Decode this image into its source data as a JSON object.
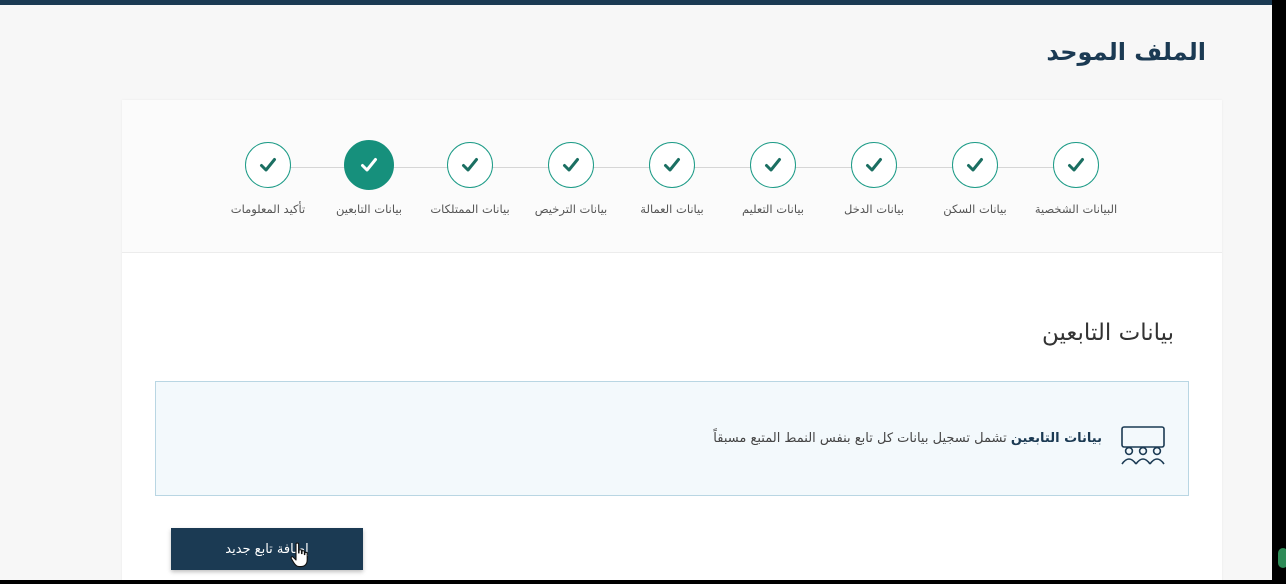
{
  "page": {
    "title": "الملف الموحد"
  },
  "stepper": {
    "steps": [
      {
        "label": "البيانات الشخصية",
        "state": "done"
      },
      {
        "label": "بيانات السكن",
        "state": "done"
      },
      {
        "label": "بيانات الدخل",
        "state": "done"
      },
      {
        "label": "بيانات التعليم",
        "state": "done"
      },
      {
        "label": "بيانات العمالة",
        "state": "done"
      },
      {
        "label": "بيانات الترخيص",
        "state": "done"
      },
      {
        "label": "بيانات الممتلكات",
        "state": "done"
      },
      {
        "label": "بيانات التابعين",
        "state": "active"
      },
      {
        "label": "تأكيد المعلومات",
        "state": "done"
      }
    ]
  },
  "section": {
    "title": "بيانات التابعين",
    "info_bold": "بيانات التابعين",
    "info_text": " تشمل تسجيل بيانات كل تابع بنفس النمط المتبع مسبقاً"
  },
  "actions": {
    "add_dependent_label": "إضافة تابع جديد"
  },
  "colors": {
    "primary": "#1b3a53",
    "accent": "#16907c",
    "info_bg": "#f3f9fc",
    "info_border": "#b9d6e3"
  },
  "icons": {
    "step_done": "check-icon",
    "info": "family-icon",
    "cursor": "hand-pointer-icon"
  }
}
